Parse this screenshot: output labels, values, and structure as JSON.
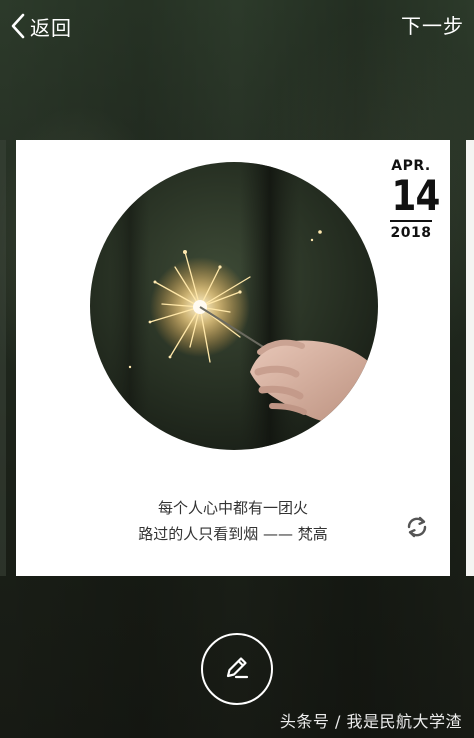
{
  "nav": {
    "back_label": "返回",
    "next_label": "下一步",
    "back_icon": "chevron-left-icon"
  },
  "card": {
    "date": {
      "month": "APR.",
      "day": "14",
      "year": "2018"
    },
    "photo_description": "sparkler-in-hand",
    "quote": {
      "line1": "每个人心中都有一团火",
      "line2": "路过的人只看到烟 —— 梵高"
    },
    "refresh_icon": "refresh-icon"
  },
  "edit_icon": "edit-pencil-icon",
  "watermark": "头条号 / 我是民航大学渣",
  "colors": {
    "card_bg": "#ffffff",
    "text_dark": "#111111",
    "quote_text": "#333333",
    "icon_gray": "#555555",
    "overlay_white": "#ffffff"
  }
}
